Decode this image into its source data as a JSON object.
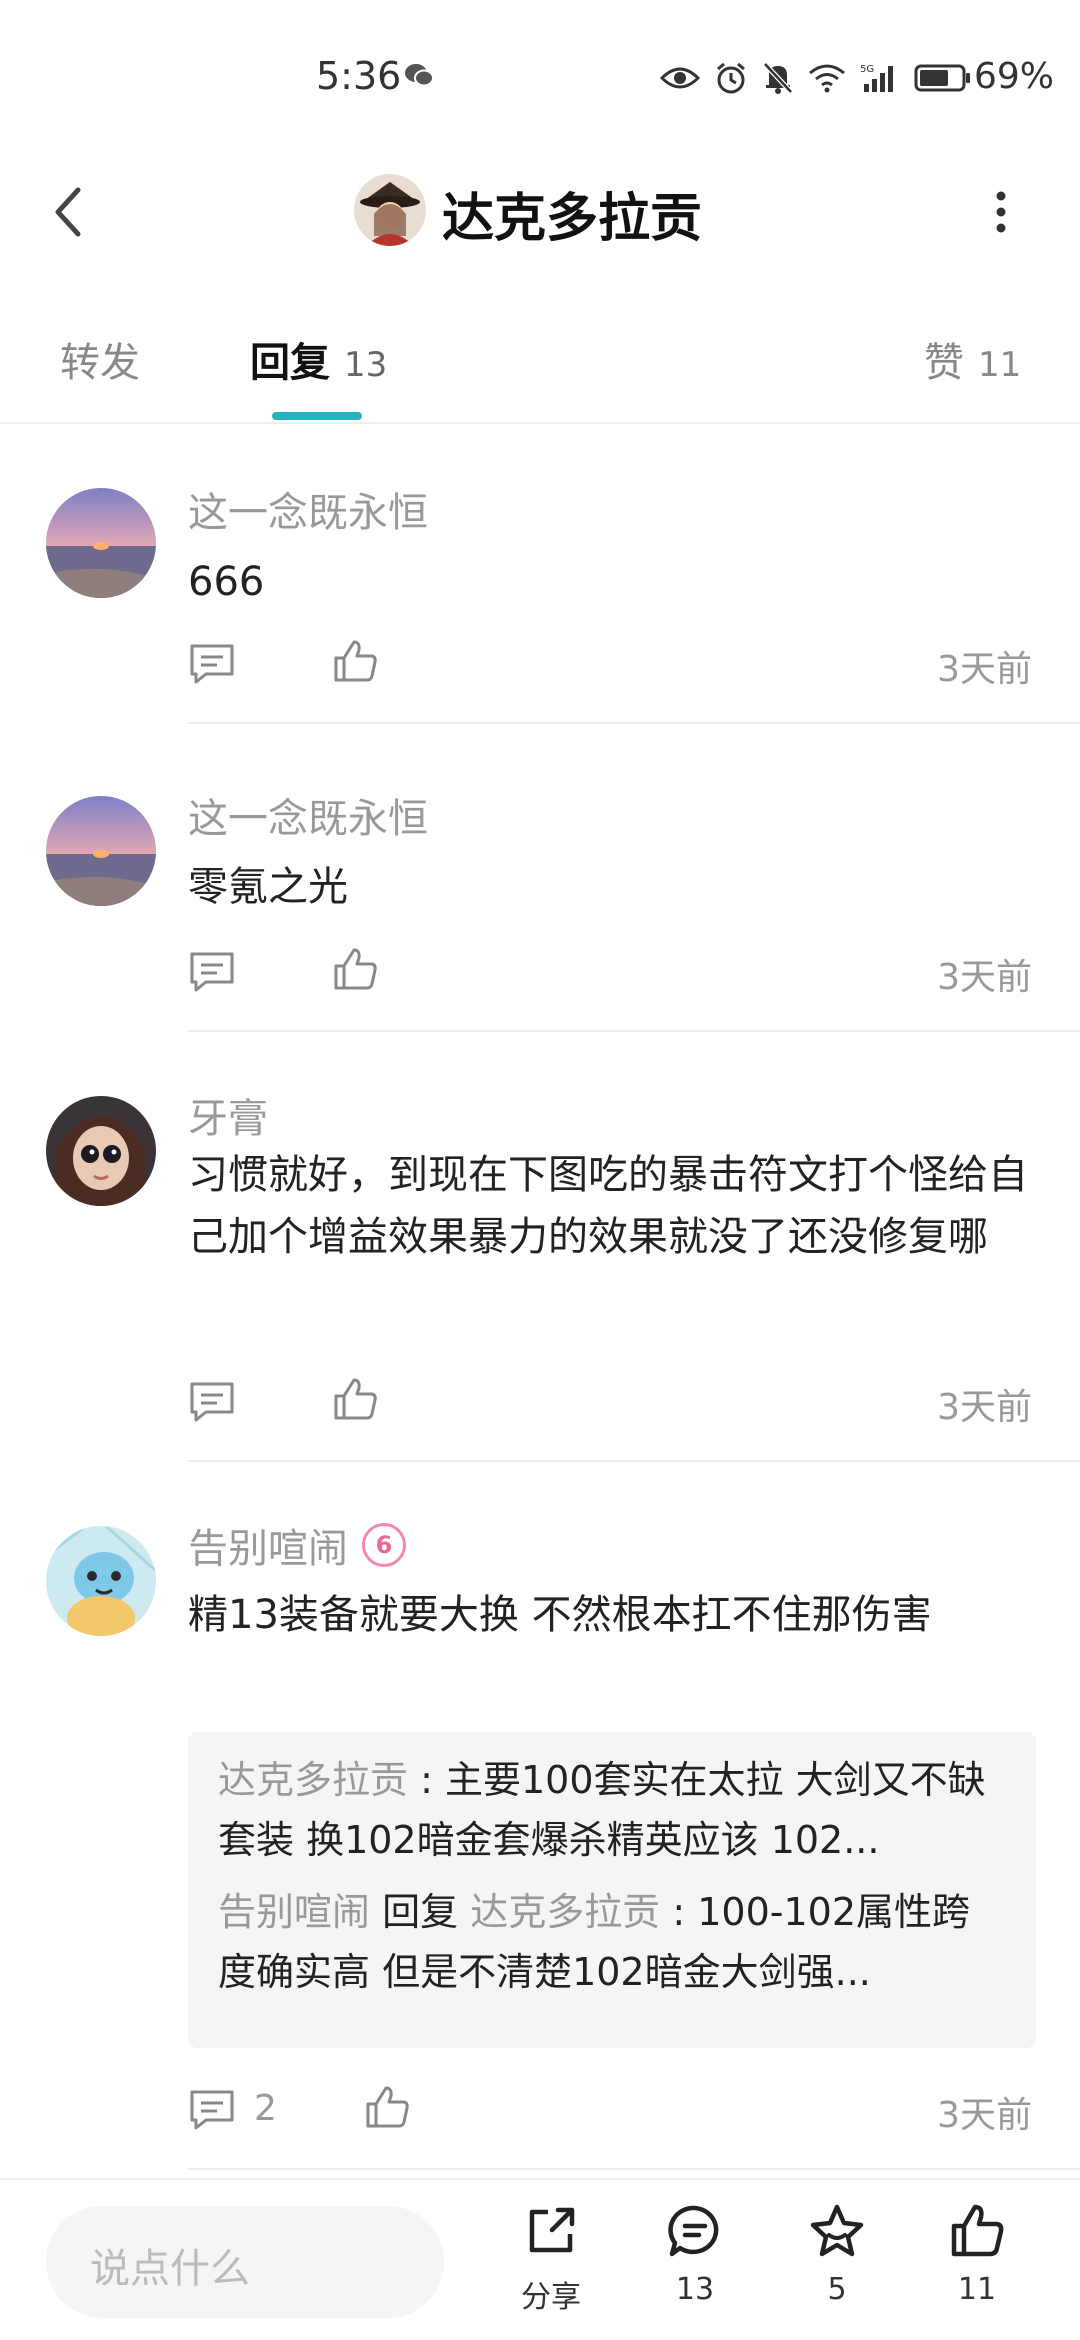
{
  "status_bar": {
    "time": "5:36",
    "battery": "69%",
    "network": "5G"
  },
  "header": {
    "title": "达克多拉贡"
  },
  "tabs": {
    "forward": {
      "label": "转发"
    },
    "reply": {
      "label": "回复",
      "count": "13"
    },
    "like": {
      "label": "赞",
      "count": "11"
    }
  },
  "comments": [
    {
      "user": "这一念既永恒",
      "text": "666",
      "time": "3天前",
      "avatar": "sunset"
    },
    {
      "user": "这一念既永恒",
      "text": "零氪之光",
      "time": "3天前",
      "avatar": "sunset"
    },
    {
      "user": "牙膏",
      "text": "习惯就好，到现在下图吃的暴击符文打个怪给自己加个增益效果暴力的效果就没了还没修复哪",
      "time": "3天前",
      "avatar": "doll"
    },
    {
      "user": "告别喧闹",
      "text": "精13装备就要大换 不然根本扛不住那伤害",
      "time": "3天前",
      "avatar": "squirtle",
      "reply_count": "2",
      "badge": "6",
      "replies": [
        {
          "user": "达克多拉贡",
          "text": "主要100套实在太拉 大剑又不缺套装 换102暗金套爆杀精英应该 102..."
        },
        {
          "user": "告别喧闹",
          "action": "回复",
          "target": "达克多拉贡",
          "text": "100-102属性跨度确实高 但是不清楚102暗金大剑强..."
        }
      ]
    }
  ],
  "bottom_bar": {
    "input_placeholder": "说点什么",
    "share_label": "分享",
    "comment_count": "13",
    "favorite_count": "5",
    "like_count": "11"
  },
  "colors": {
    "accent": "#26b3bf",
    "muted_text": "#999999",
    "reply_bg": "#f5f5f5"
  }
}
